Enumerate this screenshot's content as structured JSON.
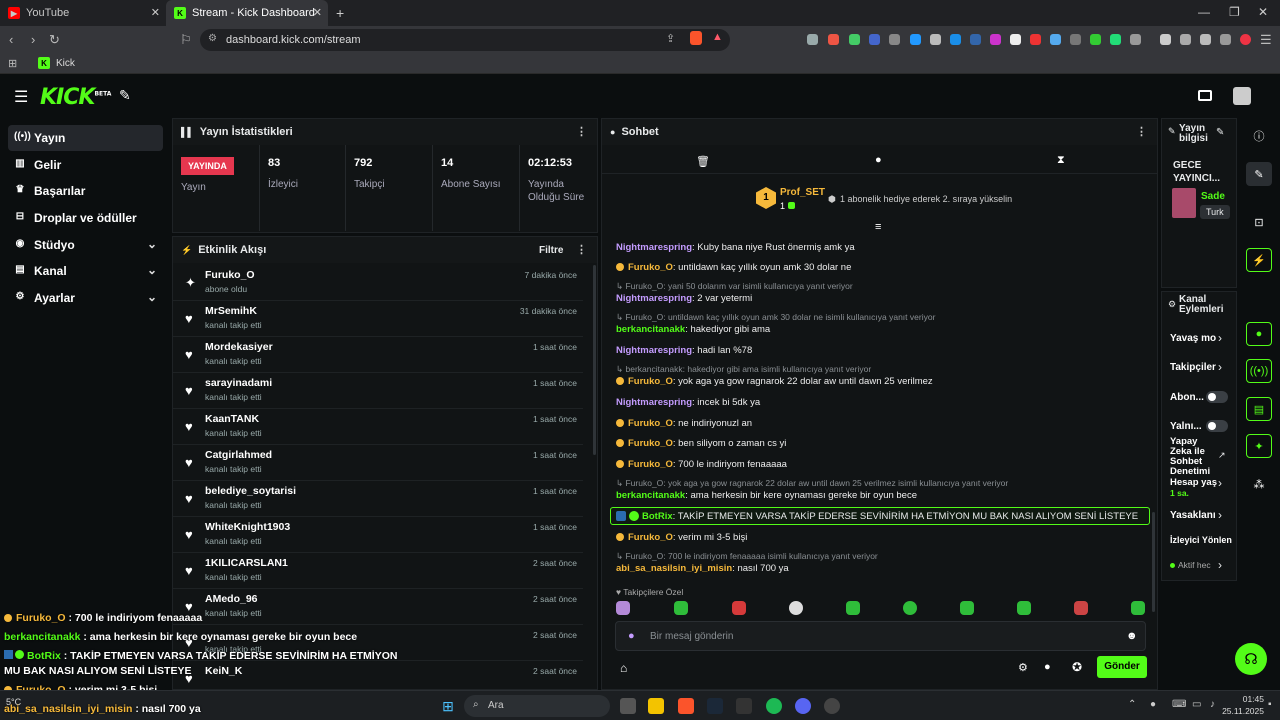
{
  "browser": {
    "tabs": [
      {
        "label": "YouTube"
      },
      {
        "label": "Stream - Kick Dashboard"
      }
    ],
    "url": "dashboard.kick.com/stream",
    "bookmark": "Kick"
  },
  "kick": {
    "logo": "KICK",
    "logo_badge": "BETA"
  },
  "sidebar": {
    "items": [
      {
        "label": "Yayın",
        "icon": "broadcast-icon"
      },
      {
        "label": "Gelir",
        "icon": "revenue-icon"
      },
      {
        "label": "Başarılar",
        "icon": "trophy-icon"
      },
      {
        "label": "Droplar ve ödüller",
        "icon": "gift-icon"
      },
      {
        "label": "Stüdyo",
        "icon": "studio-icon"
      },
      {
        "label": "Kanal",
        "icon": "channel-icon"
      },
      {
        "label": "Ayarlar",
        "icon": "gear-icon"
      }
    ]
  },
  "stats": {
    "title": "Yayın İstatistikleri",
    "live": "YAYINDA",
    "live_label": "Yayın",
    "viewers": "83",
    "viewers_label": "İzleyici",
    "followers": "792",
    "followers_label": "Takipçi",
    "subs": "14",
    "subs_label": "Abone Sayısı",
    "uptime": "02:12:53",
    "uptime_label_1": "Yayında",
    "uptime_label_2": "Olduğu Süre"
  },
  "activity": {
    "title": "Etkinlik Akışı",
    "filter": "Filtre",
    "events": [
      {
        "name": "Furuko_O",
        "sub": "abone oldu",
        "time": "7 dakika önce"
      },
      {
        "name": "MrSemihK",
        "sub": "kanalı takip etti",
        "time": "31 dakika önce"
      },
      {
        "name": "Mordekasiyer",
        "sub": "kanalı takip etti",
        "time": "1 saat önce"
      },
      {
        "name": "sarayinadami",
        "sub": "kanalı takip etti",
        "time": "1 saat önce"
      },
      {
        "name": "KaanTANK",
        "sub": "kanalı takip etti",
        "time": "1 saat önce"
      },
      {
        "name": "Catgirlahmed",
        "sub": "kanalı takip etti",
        "time": "1 saat önce"
      },
      {
        "name": "belediye_soytarisi",
        "sub": "kanalı takip etti",
        "time": "1 saat önce"
      },
      {
        "name": "WhiteKnight1903",
        "sub": "kanalı takip etti",
        "time": "1 saat önce"
      },
      {
        "name": "1KILICARSLAN1",
        "sub": "kanalı takip etti",
        "time": "2 saat önce"
      },
      {
        "name": "AMedo_96",
        "sub": "kanalı takip etti",
        "time": "2 saat önce"
      },
      {
        "name": "",
        "sub": "kanalı takip etti",
        "time": "2 saat önce"
      },
      {
        "name": "KeiN_K",
        "sub": "",
        "time": "2 saat önce"
      }
    ]
  },
  "chat": {
    "title": "Sohbet",
    "pinned_user": "Prof_SET",
    "pinned_count": "1",
    "pinned_rank": "1",
    "pinned_msg": "1 abonelik hediye ederek 2. sıraya yükselin",
    "messages": [
      {
        "user": "Nightmarespring",
        "text": ": Kuby bana niye Rust önermiş amk ya"
      },
      {
        "user": "Furuko_O",
        "text": ": untildawn kaç yıllık oyun amk 30 dolar ne"
      },
      {
        "reply": "Furuko_O: yani 50 dolarım var isimli kullanıcıya yanıt veriyor"
      },
      {
        "user": "Nightmarespring",
        "text": ": 2 var yetermi"
      },
      {
        "reply": "Furuko_O: untildawn kaç yıllık oyun amk 30 dolar ne isimli kullanıcıya yanıt veriyor"
      },
      {
        "user": "berkancitanakk",
        "text": ": hakediyor gibi ama"
      },
      {
        "user": "Nightmarespring",
        "text": ": hadi lan %78"
      },
      {
        "reply": "berkancitanakk: hakediyor gibi ama isimli kullanıcıya yanıt veriyor"
      },
      {
        "user": "Furuko_O",
        "text": ": yok aga ya gow ragnarok 22 dolar aw until dawn 25 verilmez"
      },
      {
        "user": "Nightmarespring",
        "text": ": incek bi 5dk ya"
      },
      {
        "user": "Furuko_O",
        "text": ": ne indiriyonuzl an"
      },
      {
        "user": "Furuko_O",
        "text": ": ben siliyom o zaman cs yi"
      },
      {
        "user": "Furuko_O",
        "text": ": 700 le indiriyom fenaaaaa"
      },
      {
        "reply": "Furuko_O: yok aga ya gow ragnarok 22 dolar aw until dawn 25 verilmez isimli kullanıcıya yanıt veriyor"
      },
      {
        "user": "berkancitanakk",
        "text": ": ama herkesin bir kere oynaması gereke bir oyun bece"
      },
      {
        "user": "BotRix",
        "text": ": TAKİP ETMEYEN VARSA TAKİP EDERSE SEVİNİRİM HA ETMİYON MU BAK NASI ALIYOM SENİ LİSTEYE"
      },
      {
        "user": "Furuko_O",
        "text": ": verim mi 3-5 bişi"
      },
      {
        "reply": "Furuko_O: 700 le indiriyom fenaaaaa isimli kullanıcıya yanıt veriyor"
      },
      {
        "user": "abi_sa_nasilsin_iyi_misin",
        "text": ": nasıl 700 ya"
      }
    ],
    "emote_section": "Takipçilere Özel",
    "input_placeholder": "Bir mesaj gönderin",
    "send": "Gönder"
  },
  "info": {
    "title_1": "Yayın",
    "title_2": "bilgisi",
    "stream_title_1": "GECE",
    "stream_title_2": "YAYINCI...",
    "category": "Sade",
    "lang": "Turk",
    "actions_title_1": "Kanal",
    "actions_title_2": "Eylemleri",
    "actions": [
      "Yavaş mo",
      "Takipçiler",
      "Abon...",
      "Yalnı...",
      "Yapay",
      "Zeka ile",
      "Sohbet",
      "Denetimi",
      "Hesap yaş",
      "1 sa.",
      "Yasaklanı",
      "İzleyici Yönlen",
      "Aktif hec"
    ]
  },
  "overlay": [
    {
      "user": "Furuko_O",
      "text": " : 700 le indiriyom fenaaaaa"
    },
    {
      "user": "berkancitanakk",
      "text": " : ama herkesin bir kere oynaması gereke bir oyun bece"
    },
    {
      "user": "BotRix",
      "text": " : TAKİP ETMEYEN VARSA TAKİP EDERSE SEVİNİRİM HA ETMİYON"
    },
    {
      "user": "",
      "text": "MU BAK NASI ALIYOM SENİ LİSTEYE"
    },
    {
      "user": "Furuko_O",
      "text": " : verim mi 3-5 bişi"
    },
    {
      "user": "abi_sa_nasilsin_iyi_misin",
      "text": " : nasıl 700 ya"
    }
  ],
  "taskbar": {
    "search": "Ara",
    "time": "01:45",
    "date": "25.11.2025",
    "weather": "5°C"
  }
}
